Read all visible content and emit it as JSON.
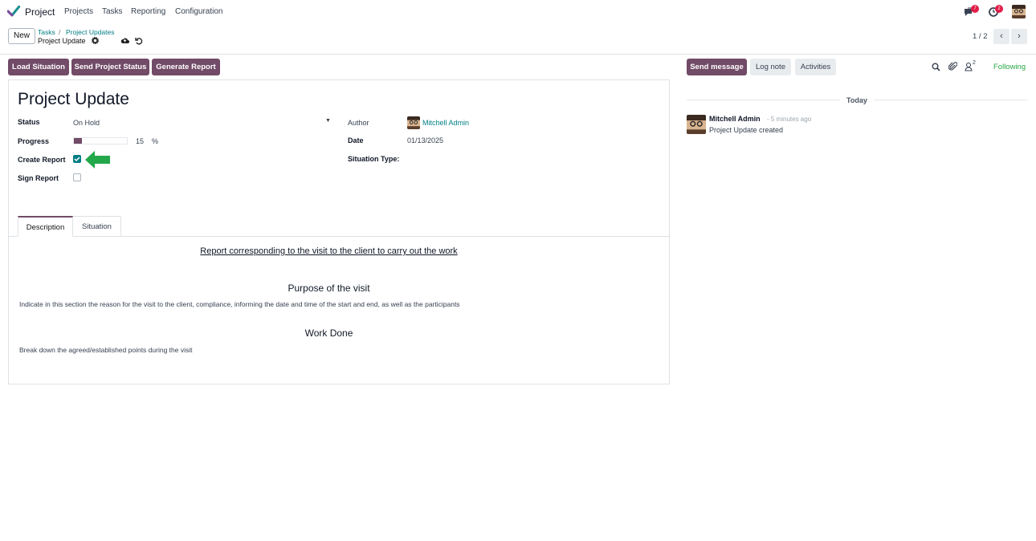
{
  "nav": {
    "app_name": "Project",
    "menu": [
      "Projects",
      "Tasks",
      "Reporting",
      "Configuration"
    ],
    "messages_count": "7",
    "activities_count": "2"
  },
  "control": {
    "new_label": "New",
    "breadcrumb_1": "Tasks",
    "breadcrumb_sep": "/",
    "breadcrumb_2": "Project Updates",
    "current_record": "Project Update",
    "pager": "1 / 2"
  },
  "actions": {
    "load_situation": "Load Situation",
    "send_status": "Send Project Status",
    "generate_report": "Generate Report"
  },
  "form": {
    "title": "Project Update",
    "status_label": "Status",
    "status_value": "On Hold",
    "progress_label": "Progress",
    "progress_value": "15",
    "progress_unit": "%",
    "progress_fraction": 0.15,
    "create_report_label": "Create Report",
    "create_report_checked": true,
    "sign_report_label": "Sign Report",
    "sign_report_checked": false,
    "author_label": "Author",
    "author_value": "Mitchell Admin",
    "date_label": "Date",
    "date_value": "01/13/2025",
    "situation_type_label": "Situation Type:"
  },
  "tabs": [
    "Description",
    "Situation"
  ],
  "description": {
    "heading": "Report corresponding to the visit to the client to carry out the work",
    "purpose_title": "Purpose of the visit",
    "purpose_text": "Indicate in this section the reason for the visit to the client, compliance, informing the date and time of the start and end, as well as the participants",
    "work_title": "Work Done",
    "work_text": "Break down the agreed/established points during the visit"
  },
  "chatter": {
    "send_message": "Send message",
    "log_note": "Log note",
    "activities": "Activities",
    "followers_count": "2",
    "following": "Following",
    "today": "Today",
    "author": "Mitchell Admin",
    "time": "- 5 minutes ago",
    "message": "Project Update created"
  },
  "colors": {
    "primary": "#714b67",
    "link": "#017e84",
    "following": "#28a745",
    "arrow": "#22a84a"
  }
}
